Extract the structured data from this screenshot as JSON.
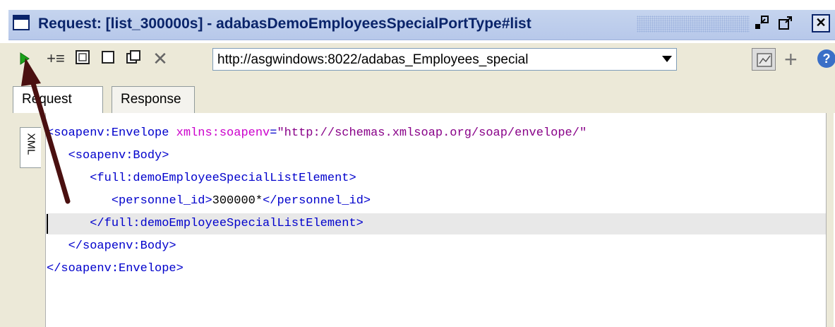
{
  "window": {
    "title": "Request: [list_300000s] - adabasDemoEmployeesSpecialPortType#list",
    "minimize_glyph": "⇱",
    "restore_glyph": "⇱",
    "close_glyph": "✕"
  },
  "toolbar": {
    "run_icon": "play-icon",
    "add_line_glyph": "+≡",
    "square1_glyph": "⧈",
    "square2_glyph": "☐",
    "copy_glyph": "⧉",
    "delete_glyph": "✕",
    "endpoint_url": "http://asgwindows:8022/adabas_Employees_special",
    "plus_glyph": "+",
    "help_glyph": "?"
  },
  "tabs": [
    {
      "label": "Request",
      "active": true
    },
    {
      "label": "Response",
      "active": false
    }
  ],
  "editor": {
    "side_tab_label": "XML",
    "lines": [
      {
        "indent": "",
        "parts": [
          {
            "cls": "tag",
            "text": "<soapenv:Envelope "
          },
          {
            "cls": "attr",
            "text": "xmlns:soapenv"
          },
          {
            "cls": "tag",
            "text": "="
          },
          {
            "cls": "val",
            "text": "\"http://schemas.xmlsoap.org/soap/envelope/\" "
          }
        ]
      },
      {
        "indent": "   ",
        "parts": [
          {
            "cls": "tag",
            "text": "<soapenv:Body>"
          }
        ]
      },
      {
        "indent": "      ",
        "parts": [
          {
            "cls": "tag",
            "text": "<full:demoEmployeeSpecialListElement>"
          }
        ]
      },
      {
        "indent": "         ",
        "parts": [
          {
            "cls": "tag",
            "text": "<personnel_id>"
          },
          {
            "cls": "txt",
            "text": "300000*"
          },
          {
            "cls": "tag",
            "text": "</personnel_id>"
          }
        ]
      },
      {
        "indent": "      ",
        "parts": [
          {
            "cls": "tag",
            "text": "</full:demoEmployeeSpecialListElement>"
          }
        ],
        "highlight": true
      },
      {
        "indent": "   ",
        "parts": [
          {
            "cls": "tag",
            "text": "</soapenv:Body>"
          }
        ]
      },
      {
        "indent": "",
        "parts": [
          {
            "cls": "tag",
            "text": "</soapenv:Envelope>"
          }
        ]
      }
    ]
  },
  "colors": {
    "title_text": "#0a246a",
    "run_green": "#1aa31a",
    "arrow": "#4a1010"
  }
}
